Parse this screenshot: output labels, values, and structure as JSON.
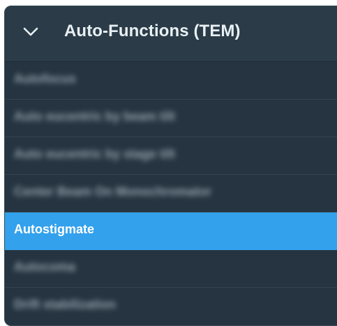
{
  "panel": {
    "title": "Auto-Functions (TEM)",
    "expanded_icon": "chevron-down-icon",
    "colors": {
      "panel_bg": "#253440",
      "header_bg": "#2b3c48",
      "selected_bg": "#33a1ec",
      "text": "#e9f0f4"
    },
    "items": [
      {
        "label": "Autofocus",
        "blurred": true,
        "selected": false
      },
      {
        "label": "Auto eucentric by beam tilt",
        "blurred": true,
        "selected": false
      },
      {
        "label": "Auto eucentric by stage tilt",
        "blurred": true,
        "selected": false
      },
      {
        "label": "Center Beam On Monochromator",
        "blurred": true,
        "selected": false
      },
      {
        "label": "Autostigmate",
        "blurred": false,
        "selected": true
      },
      {
        "label": "Autocoma",
        "blurred": true,
        "selected": false
      },
      {
        "label": "Drift stabilization",
        "blurred": true,
        "selected": false
      }
    ]
  }
}
